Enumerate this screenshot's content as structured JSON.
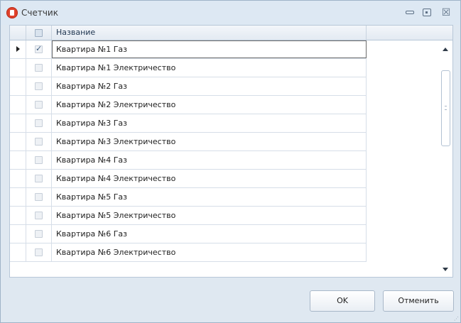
{
  "window": {
    "title": "Счетчик",
    "controls": {
      "minimize": "minimize-icon",
      "maximize": "maximize-icon",
      "close": "close-icon",
      "close_glyph": "☒"
    }
  },
  "grid": {
    "columns": {
      "name": "Название"
    },
    "rows": [
      {
        "checked": true,
        "name": "Квартира №1 Газ"
      },
      {
        "checked": false,
        "name": "Квартира №1 Электричество"
      },
      {
        "checked": false,
        "name": "Квартира №2 Газ"
      },
      {
        "checked": false,
        "name": "Квартира №2 Электричество"
      },
      {
        "checked": false,
        "name": "Квартира №3 Газ"
      },
      {
        "checked": false,
        "name": "Квартира №3 Электричество"
      },
      {
        "checked": false,
        "name": "Квартира №4 Газ"
      },
      {
        "checked": false,
        "name": "Квартира №4 Электричество"
      },
      {
        "checked": false,
        "name": "Квартира №5 Газ"
      },
      {
        "checked": false,
        "name": "Квартира №5 Электричество"
      },
      {
        "checked": false,
        "name": "Квартира №6 Газ"
      },
      {
        "checked": false,
        "name": "Квартира №6 Электричество"
      }
    ],
    "current_row": 0
  },
  "buttons": {
    "ok": "OK",
    "cancel": "Отменить"
  },
  "colors": {
    "accent": "#e0412b",
    "window_bg": "#dfe8f1",
    "border": "#b8c7d8"
  }
}
